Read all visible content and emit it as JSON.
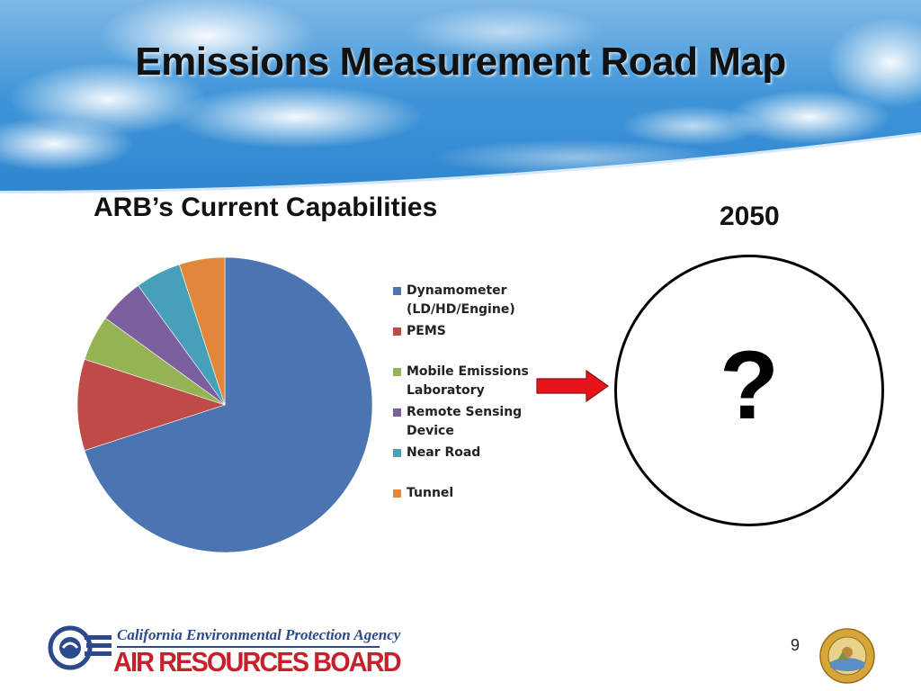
{
  "slide": {
    "title": "Emissions Measurement Road Map",
    "subtitle": "ARB’s Current Capabilities",
    "future_label": "2050",
    "unknown_symbol": "?",
    "page_number": "9"
  },
  "logo": {
    "agency": "California Environmental Protection Agency",
    "board": "AIR RESOURCES BOARD"
  },
  "seal_icon": "state-seal-icon",
  "arrow_icon": "red-right-arrow-icon",
  "colors": {
    "accent_arrow": "#e8141b",
    "sky": "#3f95d8"
  },
  "chart_data": {
    "type": "pie",
    "title": "",
    "start_angle_deg": 0,
    "direction": "clockwise",
    "legend_position": "right",
    "slices": [
      {
        "label": "Dynamometer (LD/HD/Engine)",
        "lines": [
          "Dynamometer",
          "(LD/HD/Engine)"
        ],
        "value": 70,
        "color": "#4a75b0"
      },
      {
        "label": "PEMS",
        "lines": [
          "PEMS"
        ],
        "value": 10,
        "color": "#be4b48"
      },
      {
        "label": "Mobile Emissions Laboratory",
        "lines": [
          "Mobile Emissions",
          "Laboratory"
        ],
        "value": 5,
        "color": "#94b354"
      },
      {
        "label": "Remote Sensing Device",
        "lines": [
          "Remote Sensing",
          "Device"
        ],
        "value": 5,
        "color": "#7c5f9f"
      },
      {
        "label": "Near Road",
        "lines": [
          "Near Road"
        ],
        "value": 5,
        "color": "#46a0b9"
      },
      {
        "label": "Tunnel",
        "lines": [
          "Tunnel"
        ],
        "value": 5,
        "color": "#e0873c"
      }
    ]
  }
}
